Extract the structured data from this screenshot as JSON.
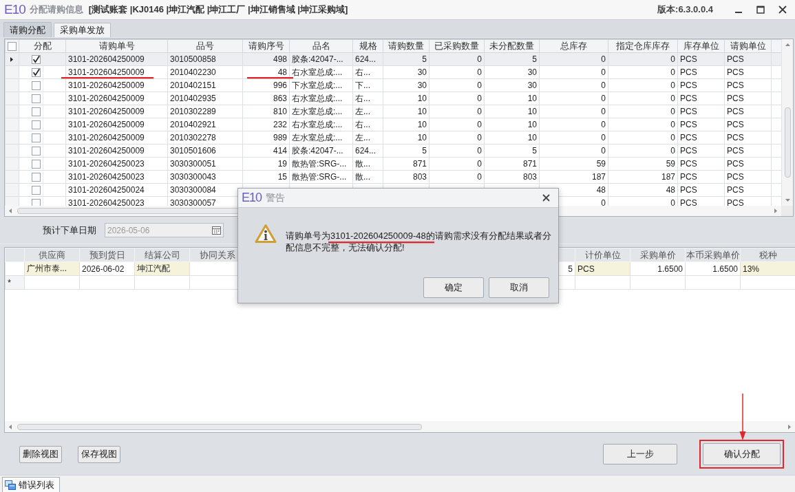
{
  "window": {
    "logo": "E10",
    "title": "分配请购信息",
    "context": "[测试账套 |KJ0146 |坤江汽配 |坤江工厂 |坤江销售域 |坤江采购域]",
    "version": "版本:6.3.0.0.4"
  },
  "tabs": [
    {
      "label": "请购分配",
      "selected": true
    },
    {
      "label": "采购单发放",
      "selected": false
    }
  ],
  "request_grid": {
    "select_all_checked": false,
    "columns": [
      "分配",
      "请购单号",
      "品号",
      "请购序号",
      "品名",
      "规格",
      "请购数量",
      "已采购数量",
      "未分配数量",
      "总库存",
      "指定仓库库存",
      "库存单位",
      "请购单位"
    ],
    "rows": [
      {
        "current": true,
        "checked": true,
        "marked": false,
        "order_no": "3101-202604250009",
        "item_no": "3010500858",
        "seq": "498",
        "name": "胶条:42047-...",
        "spec": "624...",
        "qty": "5",
        "purchased": "0",
        "unallocated": "5",
        "total_stock": "0",
        "warehouse_stock": "0",
        "stock_unit": "PCS",
        "request_unit": "PCS"
      },
      {
        "current": false,
        "checked": true,
        "marked": true,
        "order_no": "3101-202604250009",
        "item_no": "2010402230",
        "seq": "48",
        "name": "右水室总成:...",
        "spec": "右...",
        "qty": "30",
        "purchased": "0",
        "unallocated": "30",
        "total_stock": "0",
        "warehouse_stock": "0",
        "stock_unit": "PCS",
        "request_unit": "PCS"
      },
      {
        "current": false,
        "checked": false,
        "marked": false,
        "order_no": "3101-202604250009",
        "item_no": "2010402151",
        "seq": "996",
        "name": "下水室总成:...",
        "spec": "下...",
        "qty": "30",
        "purchased": "0",
        "unallocated": "30",
        "total_stock": "0",
        "warehouse_stock": "0",
        "stock_unit": "PCS",
        "request_unit": "PCS"
      },
      {
        "current": false,
        "checked": false,
        "marked": false,
        "order_no": "3101-202604250009",
        "item_no": "2010402935",
        "seq": "863",
        "name": "右水室总成:...",
        "spec": "右...",
        "qty": "10",
        "purchased": "0",
        "unallocated": "10",
        "total_stock": "0",
        "warehouse_stock": "0",
        "stock_unit": "PCS",
        "request_unit": "PCS"
      },
      {
        "current": false,
        "checked": false,
        "marked": false,
        "order_no": "3101-202604250009",
        "item_no": "2010302289",
        "seq": "810",
        "name": "左水室总成:...",
        "spec": "左...",
        "qty": "10",
        "purchased": "0",
        "unallocated": "10",
        "total_stock": "0",
        "warehouse_stock": "0",
        "stock_unit": "PCS",
        "request_unit": "PCS"
      },
      {
        "current": false,
        "checked": false,
        "marked": false,
        "order_no": "3101-202604250009",
        "item_no": "2010402921",
        "seq": "232",
        "name": "右水室总成:...",
        "spec": "右...",
        "qty": "10",
        "purchased": "0",
        "unallocated": "10",
        "total_stock": "0",
        "warehouse_stock": "0",
        "stock_unit": "PCS",
        "request_unit": "PCS"
      },
      {
        "current": false,
        "checked": false,
        "marked": false,
        "order_no": "3101-202604250009",
        "item_no": "2010302278",
        "seq": "989",
        "name": "左水室总成:...",
        "spec": "左...",
        "qty": "10",
        "purchased": "0",
        "unallocated": "10",
        "total_stock": "0",
        "warehouse_stock": "0",
        "stock_unit": "PCS",
        "request_unit": "PCS"
      },
      {
        "current": false,
        "checked": false,
        "marked": false,
        "order_no": "3101-202604250009",
        "item_no": "3010501606",
        "seq": "414",
        "name": "胶条:42047-...",
        "spec": "624...",
        "qty": "5",
        "purchased": "0",
        "unallocated": "5",
        "total_stock": "0",
        "warehouse_stock": "0",
        "stock_unit": "PCS",
        "request_unit": "PCS"
      },
      {
        "current": false,
        "checked": false,
        "marked": false,
        "order_no": "3101-202604250023",
        "item_no": "3030300051",
        "seq": "19",
        "name": "散热管:SRG-...",
        "spec": "散...",
        "qty": "871",
        "purchased": "0",
        "unallocated": "871",
        "total_stock": "59",
        "warehouse_stock": "59",
        "stock_unit": "PCS",
        "request_unit": "PCS"
      },
      {
        "current": false,
        "checked": false,
        "marked": false,
        "order_no": "3101-202604250023",
        "item_no": "3030300043",
        "seq": "15",
        "name": "散热管:SRG-...",
        "spec": "散...",
        "qty": "803",
        "purchased": "0",
        "unallocated": "803",
        "total_stock": "187",
        "warehouse_stock": "187",
        "stock_unit": "PCS",
        "request_unit": "PCS"
      },
      {
        "current": false,
        "checked": false,
        "marked": false,
        "order_no": "3101-202604250024",
        "item_no": "3030300084",
        "total_stock": "48",
        "warehouse_stock": "48",
        "stock_unit": "PCS",
        "request_unit": "PCS"
      },
      {
        "current": false,
        "checked": false,
        "marked": false,
        "order_no": "3101-202604250023",
        "item_no": "3030300057",
        "total_stock": "0",
        "warehouse_stock": "0",
        "stock_unit": "PCS",
        "request_unit": "PCS"
      }
    ]
  },
  "order_date": {
    "label": "预计下单日期",
    "value": "2026-05-06",
    "disabled": true
  },
  "supplier_grid": {
    "columns": [
      {
        "label": "供应商",
        "highlighted": true
      },
      {
        "label": "预到货日",
        "highlighted": false
      },
      {
        "label": "结算公司",
        "highlighted": true
      },
      {
        "label": "协同关系",
        "highlighted": false
      },
      {
        "highlighted": false
      },
      {
        "label": "计价单位",
        "highlighted": true
      },
      {
        "label": "采购单价",
        "highlighted": false
      },
      {
        "label": "本币采购单价",
        "highlighted": false
      },
      {
        "label": "税种",
        "highlighted": true
      }
    ],
    "rows": [
      {
        "supplier": "广州市泰...",
        "arrival_date": "2026-06-02",
        "company": "坤江汽配",
        "qty": "5",
        "price_unit": "PCS",
        "unit_price": "1.6500",
        "local_unit_price": "1.6500",
        "tax": "13%"
      }
    ],
    "new_row_marker": "*"
  },
  "dialog": {
    "logo": "E10",
    "title": "警告",
    "message": [
      {
        "text": "请购单号为",
        "marked": false
      },
      {
        "text": "3101-202604250009-48",
        "marked": true
      },
      {
        "text": "的请购需求没有分配结果或者分配信息不完整，无法确认分配!",
        "marked": false
      }
    ],
    "buttons": [
      {
        "label": "确定"
      },
      {
        "label": "取消"
      }
    ]
  },
  "footer": {
    "left_buttons": [
      {
        "label": "删除视图",
        "marked": false
      },
      {
        "label": "保存视图",
        "marked": false
      }
    ],
    "right_buttons": [
      {
        "label": "上一步",
        "marked": false
      },
      {
        "label": "确认分配",
        "marked": true
      }
    ]
  },
  "status_tabs": [
    {
      "label": "错误列表"
    }
  ]
}
